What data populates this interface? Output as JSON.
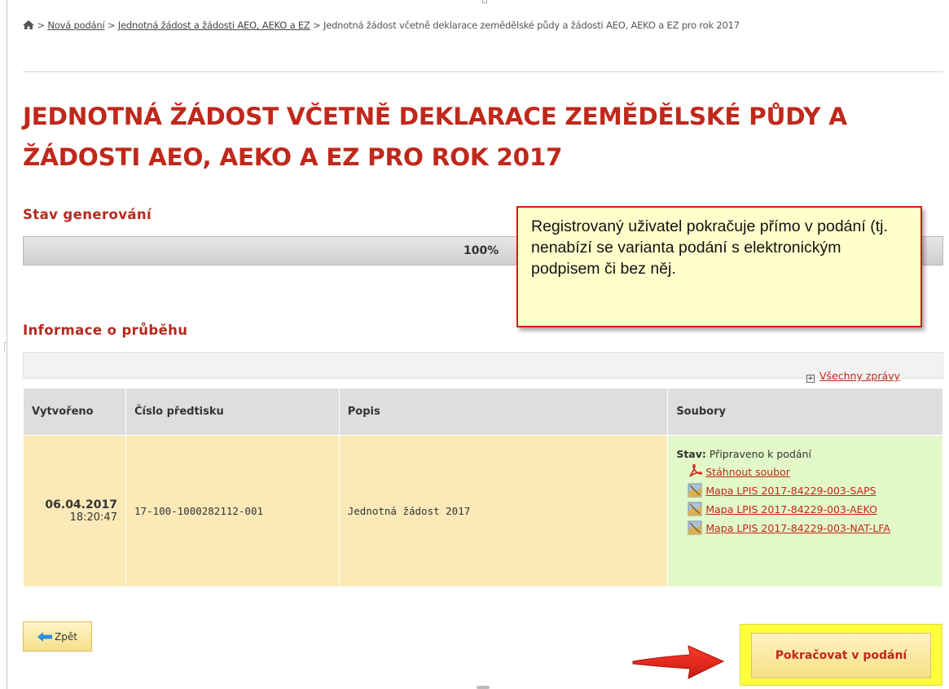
{
  "breadcrumb": {
    "home_icon": "home-icon",
    "sep": ">",
    "link1": "Nová podání",
    "link2": "Jednotná žádost a žádosti AEO, AEKO a EZ",
    "current": "Jednotná žádost včetně deklarace zemědělské půdy a žádosti AEO, AEKO a EZ pro rok 2017"
  },
  "page": {
    "title": "JEDNOTNÁ ŽÁDOST VČETNĚ DEKLARACE ZEMĚDĚLSKÉ PŮDY A ŽÁDOSTI AEO, AEKO A EZ PRO ROK 2017"
  },
  "generation": {
    "heading": "Stav generování",
    "progress_label": "100%",
    "progress_value": 100
  },
  "callout": {
    "text": "Registrovaný uživatel pokračuje přímo v podání (tj. nenabízí se varianta podání s elektronickým podpisem či bez něj."
  },
  "progress_info": {
    "heading": "Informace o průběhu",
    "all_messages_label": "Všechny zprávy"
  },
  "table": {
    "headers": [
      "Vytvořeno",
      "Číslo předtisku",
      "Popis",
      "Soubory"
    ],
    "row": {
      "date": "06.04.2017",
      "time": "18:20:47",
      "number": "17-100-1000282112-001",
      "description": "Jednotná žádost 2017",
      "status_label": "Stav:",
      "status_value": "Připraveno k podání",
      "files": [
        {
          "icon": "pdf-icon",
          "label": "Stáhnout soubor"
        },
        {
          "icon": "map-icon",
          "label": "Mapa LPIS 2017-84229-003-SAPS"
        },
        {
          "icon": "map-icon",
          "label": "Mapa LPIS 2017-84229-003-AEKO"
        },
        {
          "icon": "map-icon",
          "label": "Mapa LPIS 2017-84229-003-NAT-LFA"
        }
      ]
    }
  },
  "buttons": {
    "back": "Zpět",
    "continue": "Pokračovat v podání"
  },
  "colors": {
    "accent_red": "#c0281c",
    "callout_bg": "#ffffcc",
    "row_yellow": "#fbeab8",
    "row_green": "#e2f8c8",
    "highlight_yellow": "#ffff3c"
  }
}
